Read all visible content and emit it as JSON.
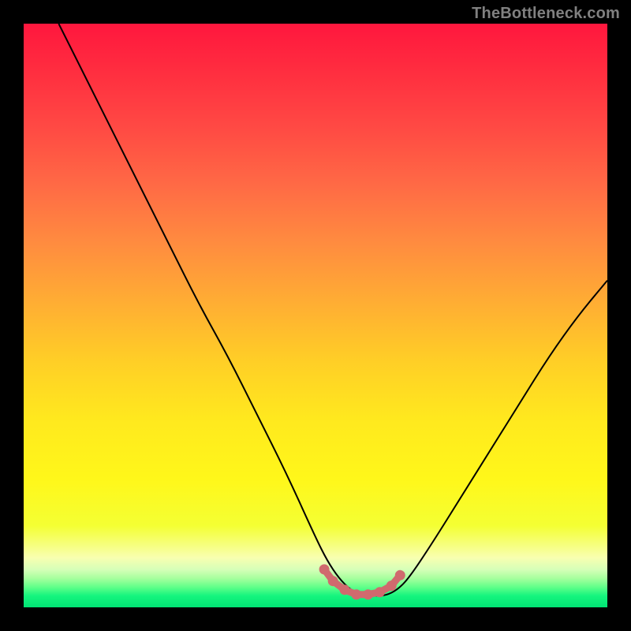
{
  "attribution": "TheBottleneck.com",
  "gradient_stops": [
    {
      "offset": 0,
      "color": "#ff173e"
    },
    {
      "offset": 0.07,
      "color": "#ff2a3f"
    },
    {
      "offset": 0.18,
      "color": "#ff4a44"
    },
    {
      "offset": 0.28,
      "color": "#ff6b45"
    },
    {
      "offset": 0.38,
      "color": "#ff8d3f"
    },
    {
      "offset": 0.48,
      "color": "#ffae33"
    },
    {
      "offset": 0.58,
      "color": "#ffcf26"
    },
    {
      "offset": 0.68,
      "color": "#ffe91e"
    },
    {
      "offset": 0.78,
      "color": "#fff71a"
    },
    {
      "offset": 0.86,
      "color": "#f4ff33"
    },
    {
      "offset": 0.915,
      "color": "#f8ffb0"
    },
    {
      "offset": 0.935,
      "color": "#d6ffb8"
    },
    {
      "offset": 0.95,
      "color": "#a8ff9e"
    },
    {
      "offset": 0.965,
      "color": "#62ff8a"
    },
    {
      "offset": 0.98,
      "color": "#16f57e"
    },
    {
      "offset": 1.0,
      "color": "#00e374"
    }
  ],
  "curve_color": "#000000",
  "curve_stroke": 2,
  "marker_color": "#d06a6e",
  "chart_data": {
    "type": "line",
    "title": "",
    "xlabel": "",
    "ylabel": "",
    "xlim": [
      0,
      100
    ],
    "ylim": [
      0,
      100
    ],
    "series": [
      {
        "name": "bottleneck-curve",
        "x": [
          6,
          10,
          15,
          20,
          25,
          30,
          35,
          40,
          45,
          50,
          52,
          54,
          56,
          58,
          60,
          62,
          64,
          66,
          70,
          75,
          80,
          85,
          90,
          95,
          100
        ],
        "y": [
          100,
          92,
          82,
          72,
          62,
          52,
          43,
          33,
          23,
          12,
          8,
          5,
          3,
          2,
          2,
          2,
          3,
          5,
          11,
          19,
          27,
          35,
          43,
          50,
          56
        ]
      }
    ],
    "markers": {
      "name": "sweet-spot",
      "x": [
        51.5,
        53,
        55,
        57,
        59,
        61,
        63,
        64.5
      ],
      "y": [
        6.5,
        4.5,
        3,
        2.2,
        2.2,
        2.6,
        3.7,
        5.5
      ]
    }
  }
}
